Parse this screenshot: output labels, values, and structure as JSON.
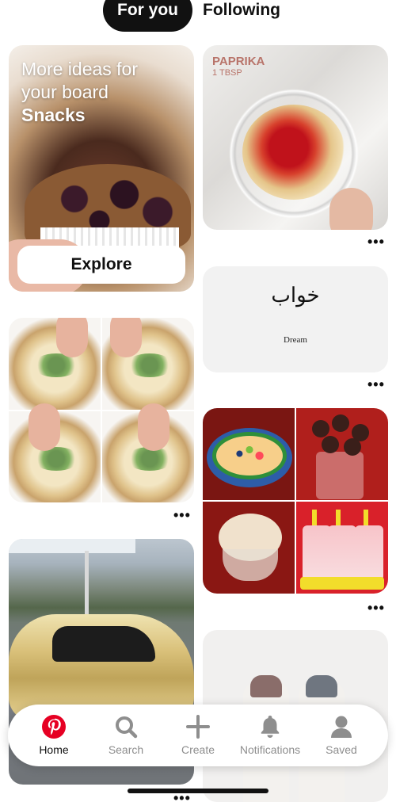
{
  "tabs": [
    {
      "label": "For you",
      "active": true
    },
    {
      "label": "Following",
      "active": false
    }
  ],
  "board_pin": {
    "line1": "More ideas for",
    "line2": "your board",
    "board_name": "Snacks",
    "button_label": "Explore"
  },
  "paprika_pin": {
    "title": "PAPRIKA",
    "amount": "1 TBSP"
  },
  "dream_pin": {
    "urdu": "خواب",
    "english": "Dream"
  },
  "more_options": "•••",
  "nav": {
    "items": [
      {
        "label": "Home",
        "icon": "pinterest-logo-icon",
        "active": true
      },
      {
        "label": "Search",
        "icon": "search-icon",
        "active": false
      },
      {
        "label": "Create",
        "icon": "plus-icon",
        "active": false
      },
      {
        "label": "Notifications",
        "icon": "bell-icon",
        "active": false
      },
      {
        "label": "Saved",
        "icon": "profile-icon",
        "active": false
      }
    ]
  },
  "colors": {
    "brand_red": "#e60023",
    "active_tab_bg": "#111111",
    "inactive_nav": "#8e8e8e"
  }
}
